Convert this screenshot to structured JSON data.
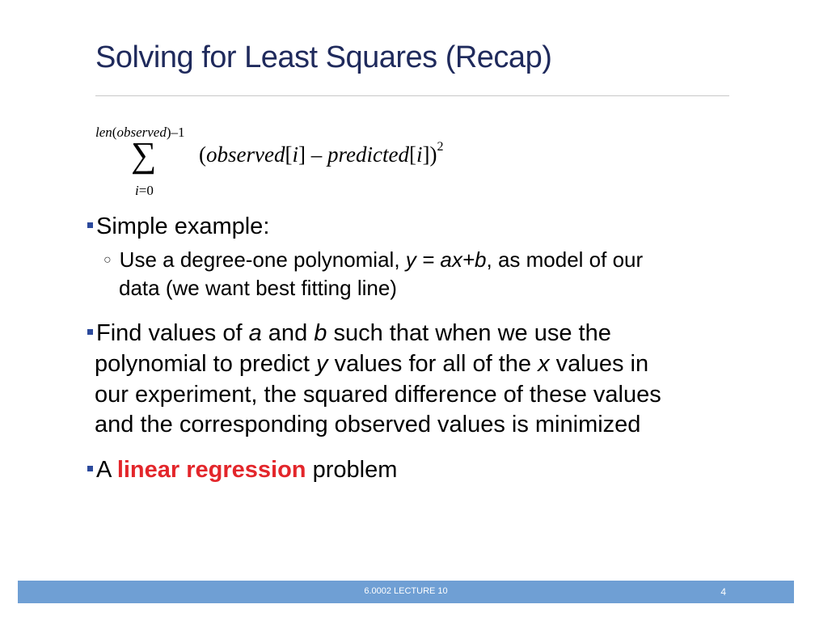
{
  "slide": {
    "title": "Solving for Least Squares (Recap)",
    "formula": {
      "upper_a": "len",
      "upper_b": "(",
      "upper_c": "observed",
      "upper_d": ")–1",
      "sigma": "∑",
      "lower_a": "i",
      "lower_b": "=0",
      "expr_a": "(",
      "expr_b": "observed",
      "expr_c": "[",
      "expr_d": "i",
      "expr_e": "] – ",
      "expr_f": "predicted",
      "expr_g": "[",
      "expr_h": "i",
      "expr_i": "])",
      "expr_sup": "2"
    },
    "bullets": {
      "b1": "Simple example:",
      "sub1_a": "Use a degree-one polynomial, ",
      "sub1_b": "y = ax+b",
      "sub1_c": ", as model of our",
      "sub1_line2": "data (we want best fitting line)",
      "b2_a": "Find values of ",
      "b2_b": "a",
      "b2_c": " and ",
      "b2_d": "b",
      "b2_e": " such that when we use the",
      "b2_line2_a": "polynomial to predict ",
      "b2_line2_b": "y",
      "b2_line2_c": " values for all of the ",
      "b2_line2_d": "x",
      "b2_line2_e": " values in",
      "b2_line3": "our experiment, the squared difference of these values",
      "b2_line4": "and the corresponding observed values is minimized",
      "b3_a": "A ",
      "b3_b": "linear regression",
      "b3_c": " problem"
    }
  },
  "footer": {
    "text": "6.0002 LECTURE 10",
    "page_number": "4"
  },
  "colors": {
    "title": "#1f2a5c",
    "bullet_square": "#2c4a9c",
    "highlight": "#e3262b",
    "footer_bar": "#6f9fd4"
  }
}
